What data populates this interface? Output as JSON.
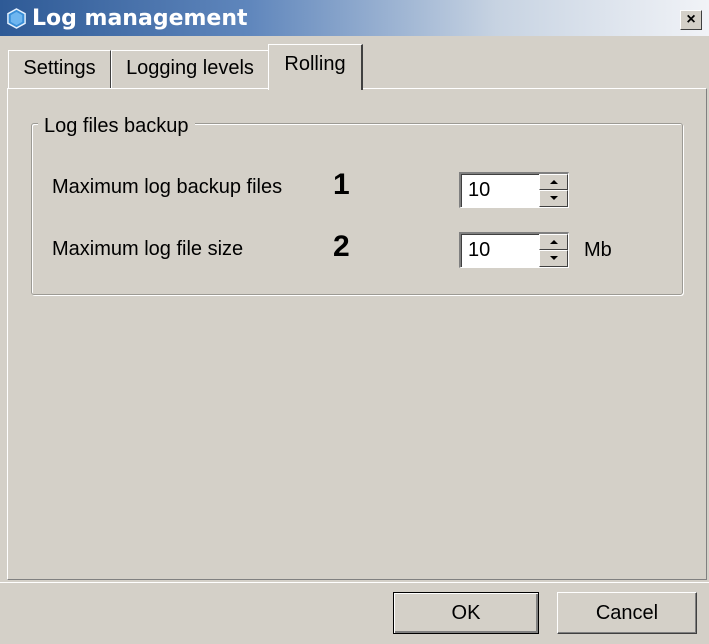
{
  "window": {
    "title": "Log management",
    "close_glyph": "×"
  },
  "tabs": [
    {
      "label": "Settings",
      "active": false
    },
    {
      "label": "Logging levels",
      "active": false
    },
    {
      "label": "Rolling",
      "active": true
    }
  ],
  "group": {
    "legend": "Log files backup",
    "fields": [
      {
        "label": "Maximum log backup files",
        "marker": "1",
        "value": "10",
        "unit": ""
      },
      {
        "label": "Maximum log file size",
        "marker": "2",
        "value": "10",
        "unit": "Mb"
      }
    ]
  },
  "footer": {
    "ok_label": "OK",
    "cancel_label": "Cancel"
  },
  "icons": {
    "app": "hexagon-app-icon",
    "close": "close-icon",
    "spin_up": "arrow-up-icon",
    "spin_down": "arrow-down-icon"
  },
  "colors": {
    "window_bg": "#d4d0c8",
    "title_start": "#2e5a96",
    "title_end": "#f1f3f7",
    "icon_blue": "#3a8fd8"
  }
}
